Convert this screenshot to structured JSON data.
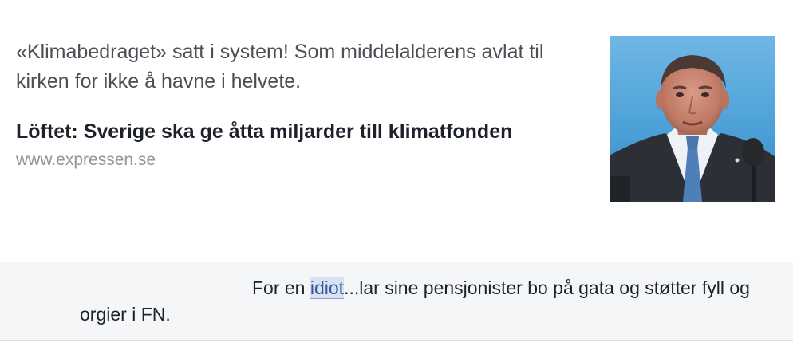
{
  "post": {
    "message": "«Klimabedraget» satt i system! Som middelalderens avlat til kirken for ikke å havne i helvete.",
    "link": {
      "title": "Löftet: Sverige ska ge åtta miljarder till klimatfonden",
      "domain": "www.expressen.se"
    }
  },
  "comment": {
    "before": "For en ",
    "highlighted": "idiot",
    "after": "...lar sine pensjonister bo på gata og støtter fyll og orgier i FN."
  }
}
